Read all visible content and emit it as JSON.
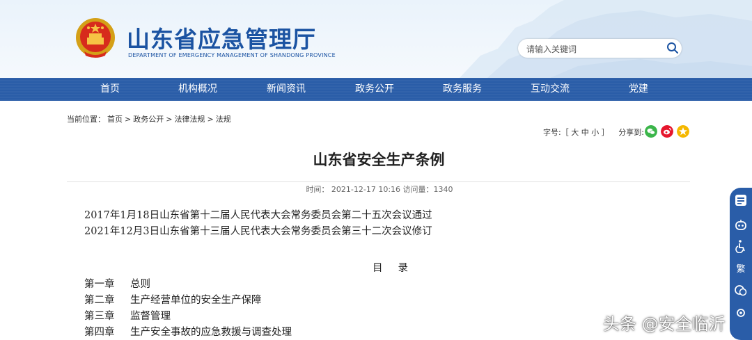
{
  "header": {
    "site_title": "山东省应急管理厅",
    "site_subtitle": "DEPARTMENT OF EMERGENCY MANAGEMENT OF SHANDONG PROVINCE",
    "search_placeholder": "请输入关键词"
  },
  "nav": {
    "items": [
      "首页",
      "机构概况",
      "新闻资讯",
      "政务公开",
      "政务服务",
      "互动交流",
      "党建"
    ]
  },
  "breadcrumb": {
    "prefix": "当前位置：",
    "items": [
      "首页",
      "政务公开",
      "法律法规",
      "法规"
    ],
    "separator": ">"
  },
  "tools": {
    "font_label": "字号:［",
    "font_large": "大",
    "font_medium": "中",
    "font_small": "小",
    "font_close": "］",
    "share_label": "分享到:"
  },
  "article": {
    "title": "山东省安全生产条例",
    "meta": "时间：  2021-12-17 10:16 访问量：1340",
    "lines": [
      "2017年1月18日山东省第十二届人民代表大会常务委员会第二十五次会议通过",
      "2021年12月3日山东省第十三届人民代表大会常务委员会第三十二次会议修订"
    ],
    "toc_title": "目录",
    "toc": [
      {
        "chapter": "第一章",
        "title": "总则"
      },
      {
        "chapter": "第二章",
        "title": "生产经营单位的安全生产保障"
      },
      {
        "chapter": "第三章",
        "title": "监督管理"
      },
      {
        "chapter": "第四章",
        "title": "生产安全事故的应急救援与调查处理"
      }
    ]
  },
  "float_bar": {
    "traditional_label": "繁"
  },
  "watermark": "头条 @安全临沂",
  "colors": {
    "brand_blue": "#1b53a2",
    "nav_blue": "#2a5da8",
    "wechat_green": "#3bb54a",
    "weibo_red": "#e6162d",
    "qzone_yellow": "#f5b800"
  }
}
